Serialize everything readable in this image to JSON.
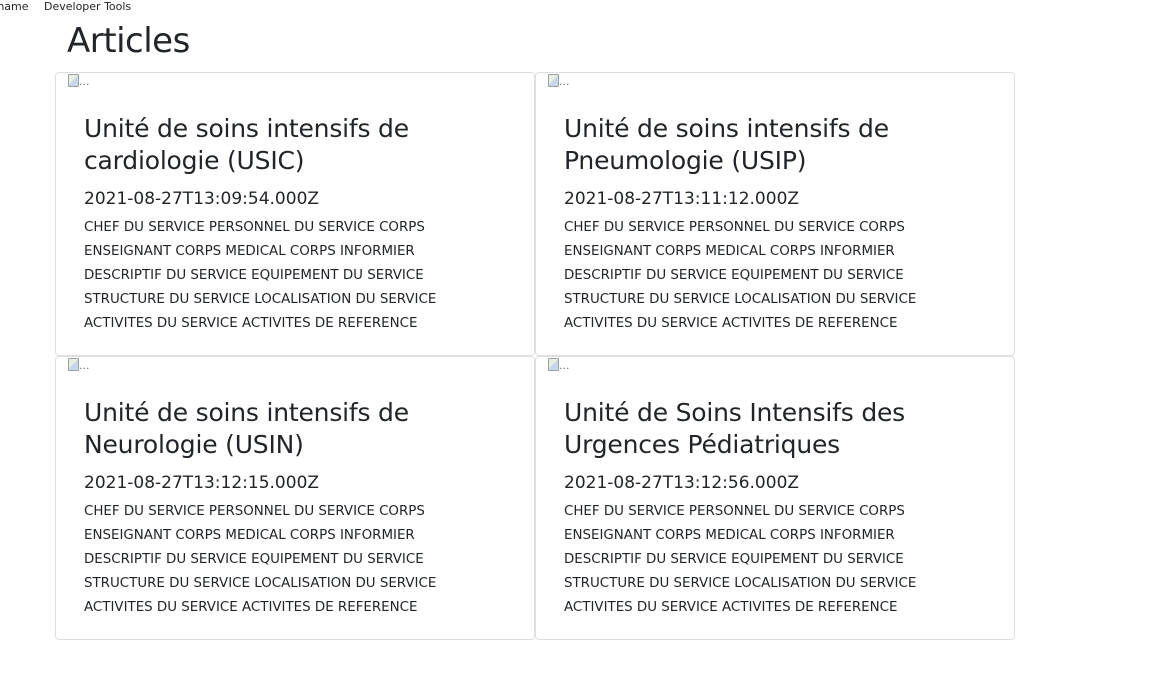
{
  "topbar": {
    "username_label": "rname",
    "devtools_label": "Developer Tools"
  },
  "page": {
    "title": "Articles"
  },
  "articles": [
    {
      "image_alt": "...",
      "title": "Unité de soins intensifs de cardiologie (USIC)",
      "date": "2021-08-27T13:09:54.000Z",
      "text": "CHEF DU SERVICE PERSONNEL DU SERVICE CORPS ENSEIGNANT CORPS MEDICAL CORPS INFORMIER DESCRIPTIF DU SERVICE EQUIPEMENT DU SERVICE STRUCTURE DU SERVICE LOCALISATION DU SERVICE ACTIVITES DU SERVICE ACTIVITES DE REFERENCE"
    },
    {
      "image_alt": "...",
      "title": "Unité de soins intensifs de Pneumologie (USIP)",
      "date": "2021-08-27T13:11:12.000Z",
      "text": "CHEF DU SERVICE PERSONNEL DU SERVICE CORPS ENSEIGNANT CORPS MEDICAL CORPS INFORMIER DESCRIPTIF DU SERVICE EQUIPEMENT DU SERVICE STRUCTURE DU SERVICE LOCALISATION DU SERVICE ACTIVITES DU SERVICE ACTIVITES DE REFERENCE"
    },
    {
      "image_alt": "...",
      "title": "Unité de soins intensifs de Neurologie (USIN)",
      "date": "2021-08-27T13:12:15.000Z",
      "text": "CHEF DU SERVICE PERSONNEL DU SERVICE CORPS ENSEIGNANT CORPS MEDICAL CORPS INFORMIER DESCRIPTIF DU SERVICE EQUIPEMENT DU SERVICE STRUCTURE DU SERVICE LOCALISATION DU SERVICE ACTIVITES DU SERVICE ACTIVITES DE REFERENCE"
    },
    {
      "image_alt": "...",
      "title": "Unité de Soins Intensifs des Urgences Pédiatriques",
      "date": "2021-08-27T13:12:56.000Z",
      "text": "CHEF DU SERVICE PERSONNEL DU SERVICE CORPS ENSEIGNANT CORPS MEDICAL CORPS INFORMIER DESCRIPTIF DU SERVICE EQUIPEMENT DU SERVICE STRUCTURE DU SERVICE LOCALISATION DU SERVICE ACTIVITES DU SERVICE ACTIVITES DE REFERENCE"
    }
  ]
}
